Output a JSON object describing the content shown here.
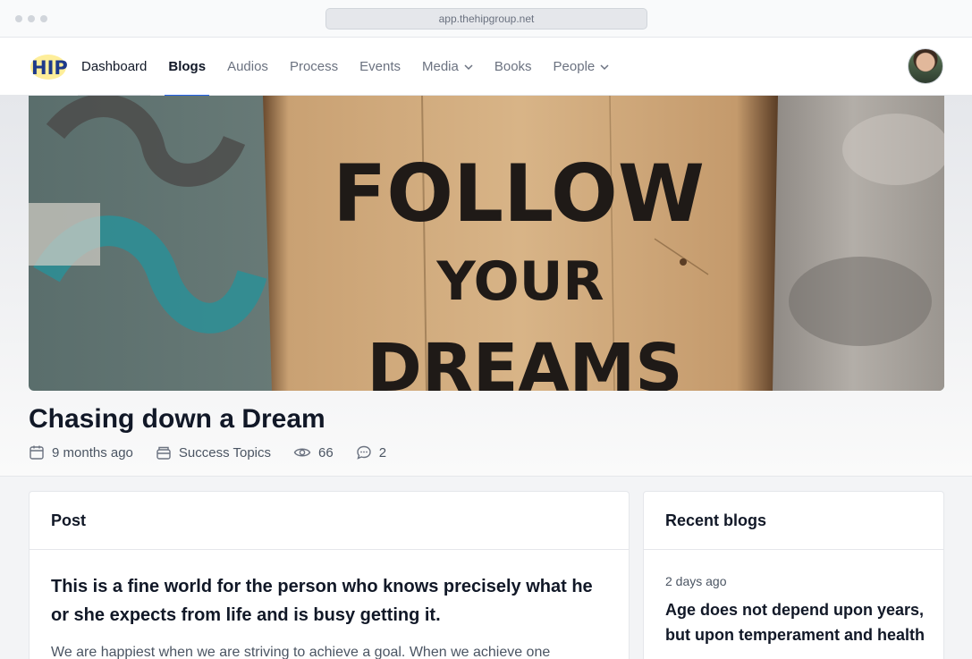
{
  "browser": {
    "url": "app.thehipgroup.net"
  },
  "nav": {
    "logo_text": "HIP",
    "items": [
      {
        "label": "Dashboard"
      },
      {
        "label": "Blogs"
      },
      {
        "label": "Audios"
      },
      {
        "label": "Process"
      },
      {
        "label": "Events"
      },
      {
        "label": "Media",
        "dropdown": true
      },
      {
        "label": "Books"
      },
      {
        "label": "People",
        "dropdown": true
      }
    ],
    "active": "Blogs"
  },
  "hero": {
    "sign_lines": [
      "FOLLOW",
      "YOUR",
      "DREAMS"
    ]
  },
  "post": {
    "title": "Chasing down a Dream",
    "meta": {
      "date": "9 months ago",
      "category": "Success Topics",
      "views": "66",
      "comments": "2"
    },
    "section_title": "Post",
    "lead": "This is a fine world for the person who knows precisely what he or she expects from life and is busy getting it.",
    "body": "We are happiest when we are striving to achieve a goal. When we achieve one"
  },
  "recent": {
    "title": "Recent blogs",
    "items": [
      {
        "date": "2 days ago",
        "title": "Age does not depend upon years, but upon temperament and health"
      }
    ]
  },
  "colors": {
    "accent": "#2563eb",
    "text": "#111827",
    "muted": "#6b7280"
  }
}
